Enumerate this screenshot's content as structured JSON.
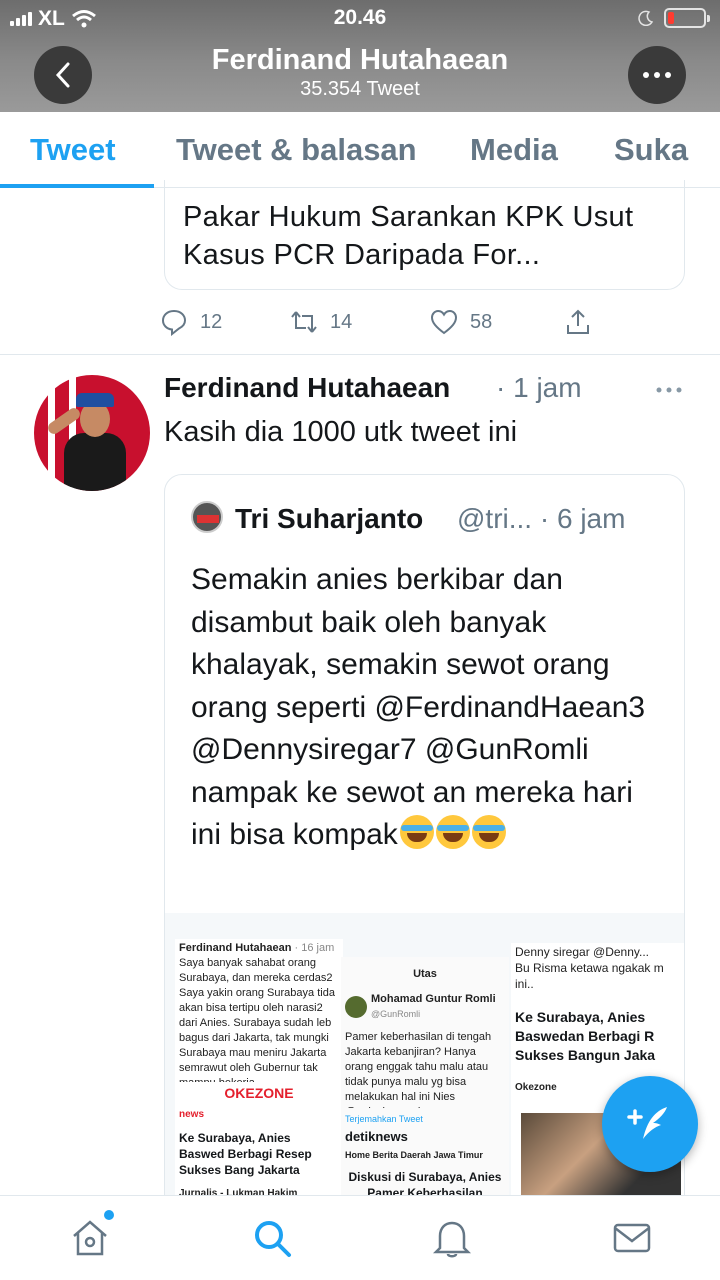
{
  "status_bar": {
    "carrier": "XL",
    "time": "20.46"
  },
  "header": {
    "name": "Ferdinand Hutahaean",
    "tweet_count": "35.354 Tweet"
  },
  "tabs": [
    {
      "label": "Tweet",
      "active": true
    },
    {
      "label": "Tweet & balasan",
      "active": false
    },
    {
      "label": "Media",
      "active": false
    },
    {
      "label": "Suka",
      "active": false
    }
  ],
  "prev_tweet": {
    "card_title": "Pakar Hukum Sarankan KPK Usut Kasus PCR Daripada For...",
    "replies": "12",
    "retweets": "14",
    "likes": "58"
  },
  "tweet": {
    "author": "Ferdinand Hutahaean",
    "time": "· 1 jam",
    "text": "Kasih dia 1000 utk tweet ini",
    "quote": {
      "author": "Tri Suharjanto",
      "handle_time": "@tri... · 6 jam",
      "text": "Semakin anies berkibar dan disambut baik oleh banyak khalayak, semakin sewot orang orang seperti @FerdinandHaean3 @Dennysiregar7 @GunRomli nampak ke sewot an mereka hari ini bisa kompak",
      "media": {
        "left_name": "Ferdinand Hutahaean",
        "left_time": "· 16 jam",
        "left_text": "Saya banyak sahabat orang Surabaya, dan mereka cerdas2 Saya yakin orang Surabaya tida akan bisa tertipu oleh narasi2 dari Anies. Surabaya sudah leb bagus dari Jakarta, tak mungki Surabaya mau meniru Jakarta semrawut oleh Gubernur tak mampu bekerja.",
        "left_logo": "OKEZONE",
        "left_news": "news",
        "left_headline": "Ke Surabaya, Anies Baswed Berbagi Resep Sukses Bang Jakarta",
        "left_author": "Jurnalis - Lukman Hakim",
        "mid_title": "Utas",
        "mid_name": "Mohamad Guntur Romli",
        "mid_handle": "@GunRomli",
        "mid_text": "Pamer keberhasilan di tengah Jakarta kebanjiran? Hanya orang enggak tahu malu atau tidak punya malu yg bisa melakukan hal ini Nies @aniesbaswedan",
        "mid_translate": "Terjemahkan Tweet",
        "mid_logo": "detiknews",
        "mid_nav": "Home  Berita  Daerah  Jawa Timur",
        "mid_headline": "Diskusi di Surabaya, Anies Pamer Keberhasilan",
        "right_name": "Denny siregar @Denny...",
        "right_text": "Bu Risma ketawa ngakak m ini..",
        "right_headline": "Ke Surabaya, Anies Baswedan Berbagi R Sukses Bangun Jaka",
        "right_source": "Okezone"
      }
    }
  },
  "colors": {
    "accent": "#1da1f2",
    "secondary_text": "#657786",
    "border": "#e1e8ed"
  }
}
